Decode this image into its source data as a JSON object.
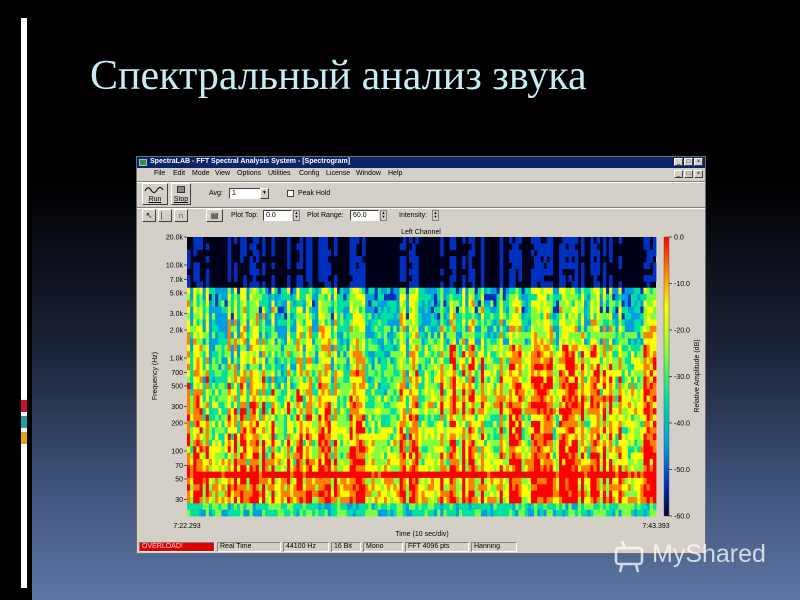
{
  "slide": {
    "title": "Спектральный анализ звука"
  },
  "window": {
    "title": "SpectraLAB - FFT Spectral Analysis System - [Spectrogram]",
    "controls": [
      "_",
      "□",
      "×"
    ]
  },
  "menu": [
    "File",
    "Edit",
    "Mode",
    "View",
    "Options",
    "Utilities",
    "Config",
    "License",
    "Window",
    "Help"
  ],
  "toolbar1": {
    "run_label": "Run",
    "stop_label": "Stop",
    "avg_label": "Avg:",
    "avg_value": "1",
    "peak_hold_label": "Peak Hold"
  },
  "toolbar2": {
    "plot_top_label": "Plot Top:",
    "plot_top_value": "0.0",
    "plot_range_label": "Plot Range:",
    "plot_range_value": "60.0",
    "intensity_label": "Intensity:"
  },
  "chart_data": {
    "type": "heatmap",
    "title": "Left Channel",
    "xlabel": "Time (10 sec/div)",
    "ylabel": "Frequency (Hz)",
    "x_start": "7:22.293",
    "x_end": "7:43.393",
    "y_scale": "log",
    "y_range": [
      20,
      20000
    ],
    "y_ticks": [
      "20.0k",
      "10.0k",
      "7.0k",
      "5.0k",
      "3.0k",
      "2.0k",
      "1.0k",
      "700",
      "500",
      "300",
      "200",
      "100",
      "70",
      "50",
      "30"
    ],
    "y_tick_values": [
      20000,
      10000,
      7000,
      5000,
      3000,
      2000,
      1000,
      700,
      500,
      300,
      200,
      100,
      70,
      50,
      30
    ],
    "colorbar_label": "Relative Amplitude (dB)",
    "colorbar_ticks": [
      "0.0",
      "-10.0",
      "-20.0",
      "-30.0",
      "-40.0",
      "-50.0",
      "-60.0"
    ],
    "colorbar_tick_values": [
      0,
      -10,
      -20,
      -30,
      -40,
      -50,
      -60
    ],
    "colorscale": [
      "#000030",
      "#0030c0",
      "#00a0e0",
      "#00e0a0",
      "#80ff40",
      "#ffff00",
      "#ff8000",
      "#ff0000"
    ]
  },
  "status": {
    "overload": "OVERLOAD!",
    "mode": "Real Time",
    "sample_rate": "44100 Hz",
    "bits": "16 Bit",
    "channels": "Mono",
    "fft_size": "FFT 4096 pts",
    "window": "Hanning"
  },
  "watermark": {
    "text": "MyShared"
  },
  "colors": {
    "title_text": "#c5ecf4",
    "titlebar": "#0a246a",
    "window_bg": "#d4d0c8",
    "overload_bg": "#e00000",
    "deco_red": "#c8102e",
    "deco_teal": "#2a9aa8",
    "deco_gold": "#e0a020"
  },
  "icons": [
    "app-icon",
    "run-icon",
    "stop-icon",
    "pointer-icon",
    "cursor-icon",
    "marker-icon",
    "view-icon",
    "watermark-icon"
  ]
}
